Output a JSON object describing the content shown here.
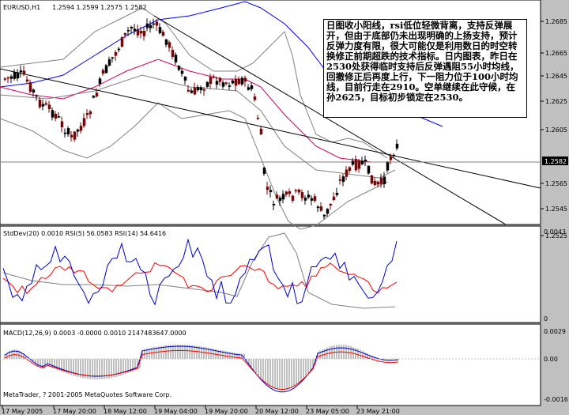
{
  "header": {
    "symbol_tf": "EURUSD,H1",
    "ohlc": "1.2594 1.2599 1.2575 1.2582"
  },
  "annotation": "日图收小阳线，rsi低位轻微背离，支持反弹展开，但由于底部仍未出现明确的上扬支持，预计反弹力度有限，很大可能仅是利用数日的时空转换修正前期超跌的技术指标。日内图表，昨日在2530处获得临时支持后反弹遇阻55小时均线，回撤修正后再度上行，下一阻力位于100小时均线，目前行走在2910。空单继续在此守候，在孙2625，目标初步锁定在2530。",
  "main_axis": {
    "labels": [
      "1.2685",
      "1.2665",
      "1.2645",
      "1.2625",
      "1.2605",
      "1.2565",
      "1.2545",
      "1.2525"
    ],
    "current_price": "1.2582"
  },
  "indicator1": {
    "label": "StdDev(20) 0.0010  RSI(5) 56.0583  RSI(14) 54.6416",
    "axis": [
      "0.0043",
      "0"
    ]
  },
  "indicator2": {
    "label": "MACD(12,26,9) 0.0003 -0.0000 0.0010 2147483647.0000",
    "axis": [
      "0.0029",
      "0.00",
      "-0.0016"
    ],
    "copyright": "MetaTrader, ? 2001-2005 MetaQuotes Software Corp."
  },
  "time_axis": [
    "17 May 2005",
    "17 May 20:00",
    "18 May 12:00",
    "19 May 04:00",
    "19 May 20:00",
    "20 May 12:00",
    "23 May 05:00",
    "23 May 21:00"
  ],
  "colors": {
    "background": "#c0c0c0",
    "plot": "#ffffff",
    "candle_up": "#000000",
    "candle_down": "#800000",
    "ma_blue": "#0000ff",
    "ma_magenta": "#cc0066",
    "bands": "#808080",
    "rsi5": "#0000cc",
    "rsi14": "#ff0000",
    "macd_signal": "#ff0000"
  }
}
